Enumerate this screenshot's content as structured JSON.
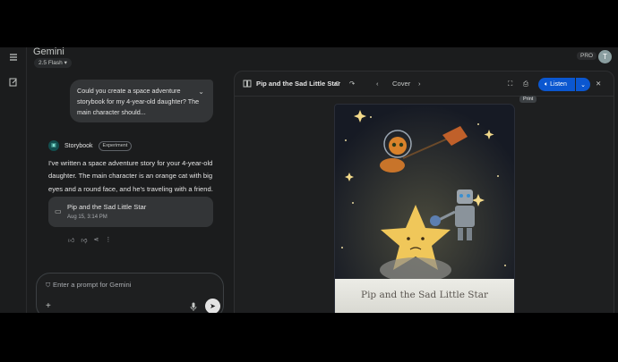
{
  "header": {
    "app_title": "Gemini",
    "model": "2.5 Flash",
    "pro_badge": "PRO",
    "avatar_letter": "T"
  },
  "icons": {
    "menu": "menu-icon",
    "new_chat": "edit-icon",
    "storybook": "storybook-icon",
    "book": "book-icon",
    "undo": "undo-icon",
    "redo": "redo-icon",
    "prev": "chevron-left-icon",
    "next": "chevron-right-icon",
    "fullscreen": "fullscreen-icon",
    "print": "print-icon",
    "speaker": "speaker-icon",
    "close": "close-icon",
    "shield": "shield-icon",
    "plus": "plus-icon",
    "mic": "mic-icon",
    "send": "send-icon"
  },
  "chat": {
    "user_message": "Could you create a space adventure storybook for my 4-year-old daughter? The main character should...",
    "reply_label": "Storybook",
    "reply_badge": "Experiment",
    "reply_text": "I've written a space adventure story for your 4-year-old daughter. The main character is an orange cat with big eyes and a round face, and he's traveling with a friend.",
    "doc_title": "Pip and the Sad Little Star",
    "doc_date": "Aug 15, 3:14 PM"
  },
  "prompt": {
    "placeholder": "Enter a prompt for Gemini"
  },
  "panel": {
    "title": "Pip and the Sad Little Star",
    "page_label": "Cover",
    "listen_label": "Listen",
    "tooltip": "Print"
  },
  "book": {
    "cover_title": "Pip and the Sad Little Star"
  },
  "colors": {
    "background": "#1b1c1d",
    "accent": "#0b57d0",
    "bubble": "#333537"
  }
}
